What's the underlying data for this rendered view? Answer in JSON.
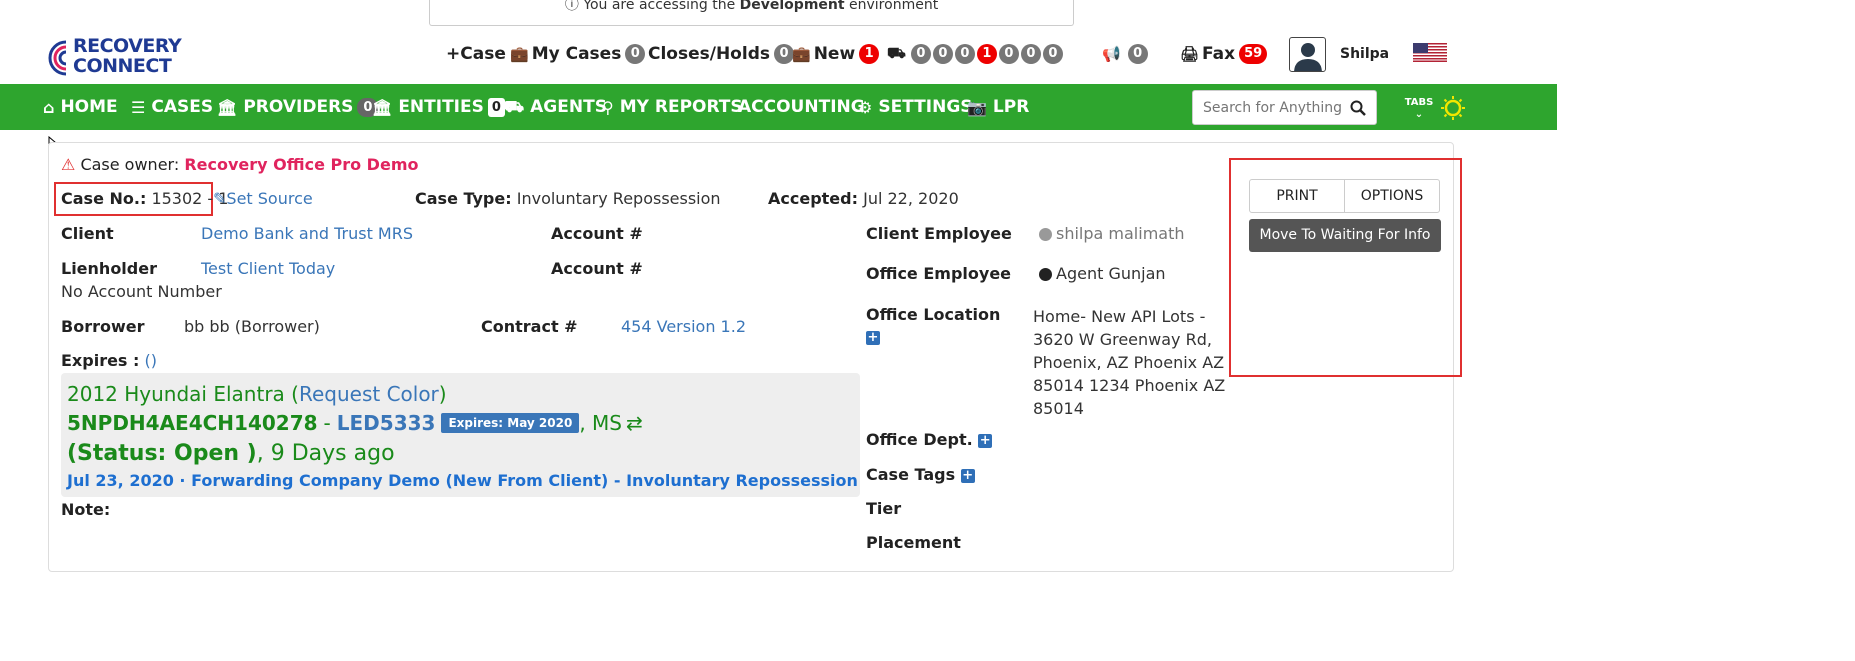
{
  "env_banner": {
    "prefix": "You are accessing the",
    "env": "Development",
    "suffix": "environment"
  },
  "logo": {
    "line1": "RECOVERY",
    "line2": "CONNECT"
  },
  "topnav": {
    "case": "Case",
    "my_cases": "My Cases",
    "my_cases_count": "0",
    "closes_holds": "Closes/Holds",
    "closes_holds_count": "0",
    "new": "New",
    "new_count": "1",
    "truck_counts": [
      "0",
      "0",
      "0",
      "1",
      "0",
      "0",
      "0"
    ],
    "announce_count": "0",
    "fax": "Fax",
    "fax_count": "59",
    "user": "Shilpa"
  },
  "greennav": {
    "home": "HOME",
    "cases": "CASES",
    "providers": "PROVIDERS",
    "providers_count": "0",
    "entities": "ENTITIES",
    "entities_count": "0",
    "agents": "AGENTS",
    "my_reports": "MY REPORTS",
    "accounting": "ACCOUNTING",
    "settings": "SETTINGS",
    "lpr": "LPR",
    "search_placeholder": "Search for Anything",
    "tabs": "TABS"
  },
  "case": {
    "owner_label": "Case owner:",
    "owner": "Recovery Office Pro Demo",
    "case_no_label": "Case No.:",
    "case_no": "15302 - 1",
    "set_source": "Set Source",
    "case_type_label": "Case Type:",
    "case_type": "Involuntary Repossession",
    "accepted_label": "Accepted:",
    "accepted": "Jul 22, 2020",
    "client_label": "Client",
    "client": "Demo Bank and Trust MRS",
    "account_label": "Account #",
    "lienholder_label": "Lienholder",
    "lienholder": "Test Client Today",
    "no_account": "No Account Number",
    "borrower_label": "Borrower",
    "borrower": "bb bb (Borrower)",
    "contract_label": "Contract #",
    "contract": "454 Version 1.2",
    "expires_label": "Expires :",
    "expires_val": "()",
    "client_employee_label": "Client Employee",
    "client_employee": "shilpa malimath",
    "office_employee_label": "Office Employee",
    "office_employee": "Agent Gunjan",
    "office_location_label": "Office Location",
    "office_location": [
      "Home- New API Lots -",
      "3620 W Greenway Rd,",
      "Phoenix, AZ Phoenix AZ",
      "85014 1234 Phoenix AZ",
      "85014"
    ],
    "office_dept_label": "Office Dept.",
    "case_tags_label": "Case Tags",
    "tier_label": "Tier",
    "placement_label": "Placement",
    "note_label": "Note:"
  },
  "vehicle": {
    "title": "2012 Hyundai Elantra",
    "request_color": "Request Color",
    "vin": "5NPDH4AE4CH140278",
    "plate": "LED5333",
    "expires_badge": "Expires: May 2020",
    "state": ", MS",
    "status": "(Status: Open )",
    "ago": ", 9 Days ago",
    "history": "Jul 23, 2020 · Forwarding Company Demo (New From Client) - Involuntary Repossession"
  },
  "actions": {
    "print": "PRINT",
    "options": "OPTIONS",
    "move": "Move To Waiting For Info"
  },
  "colors": {
    "green": "#2ea52e",
    "owner_red": "#e0245e",
    "link_blue": "#3a76b8",
    "vehicle_green": "#1a8a1a"
  }
}
